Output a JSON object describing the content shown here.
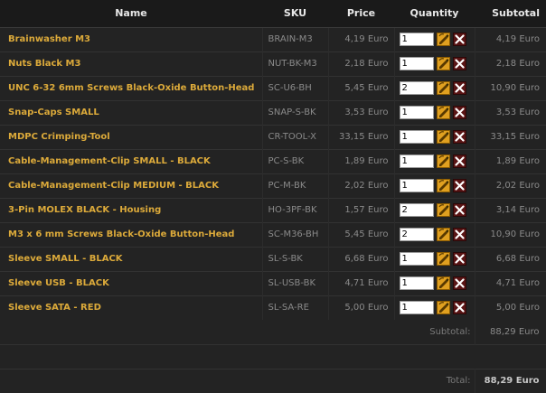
{
  "headers": {
    "name": "Name",
    "sku": "SKU",
    "price": "Price",
    "quantity": "Quantity",
    "subtotal": "Subtotal"
  },
  "items": [
    {
      "name": "Brainwasher M3",
      "sku": "BRAIN-M3",
      "price": "4,19 Euro",
      "qty": "1",
      "subtotal": "4,19 Euro"
    },
    {
      "name": "Nuts Black M3",
      "sku": "NUT-BK-M3",
      "price": "2,18 Euro",
      "qty": "1",
      "subtotal": "2,18 Euro"
    },
    {
      "name": "UNC 6-32 6mm Screws Black-Oxide Button-Head",
      "sku": "SC-U6-BH",
      "price": "5,45 Euro",
      "qty": "2",
      "subtotal": "10,90 Euro"
    },
    {
      "name": "Snap-Caps SMALL",
      "sku": "SNAP-S-BK",
      "price": "3,53 Euro",
      "qty": "1",
      "subtotal": "3,53 Euro"
    },
    {
      "name": "MDPC Crimping-Tool",
      "sku": "CR-TOOL-X",
      "price": "33,15 Euro",
      "qty": "1",
      "subtotal": "33,15 Euro"
    },
    {
      "name": "Cable-Management-Clip SMALL - BLACK",
      "sku": "PC-S-BK",
      "price": "1,89 Euro",
      "qty": "1",
      "subtotal": "1,89 Euro"
    },
    {
      "name": "Cable-Management-Clip MEDIUM - BLACK",
      "sku": "PC-M-BK",
      "price": "2,02 Euro",
      "qty": "1",
      "subtotal": "2,02 Euro"
    },
    {
      "name": "3-Pin MOLEX BLACK - Housing",
      "sku": "HO-3PF-BK",
      "price": "1,57 Euro",
      "qty": "2",
      "subtotal": "3,14 Euro"
    },
    {
      "name": "M3 x 6 mm Screws Black-Oxide Button-Head",
      "sku": "SC-M36-BH",
      "price": "5,45 Euro",
      "qty": "2",
      "subtotal": "10,90 Euro"
    },
    {
      "name": "Sleeve SMALL - BLACK",
      "sku": "SL-S-BK",
      "price": "6,68 Euro",
      "qty": "1",
      "subtotal": "6,68 Euro"
    },
    {
      "name": "Sleeve USB - BLACK",
      "sku": "SL-USB-BK",
      "price": "4,71 Euro",
      "qty": "1",
      "subtotal": "4,71 Euro"
    },
    {
      "name": "Sleeve SATA - RED",
      "sku": "SL-SA-RE",
      "price": "5,00 Euro",
      "qty": "1",
      "subtotal": "5,00 Euro"
    }
  ],
  "summary": {
    "subtotal_label": "Subtotal:",
    "subtotal_value": "88,29 Euro",
    "total_label": "Total:",
    "total_value": "88,29 Euro"
  },
  "icons": {
    "update": "refresh-pencil-icon",
    "remove": "remove-x-icon"
  },
  "colors": {
    "product_name": "#dcaa3a",
    "update_icon_bg": "#e0a020",
    "remove_icon_bg": "#5a1414"
  }
}
